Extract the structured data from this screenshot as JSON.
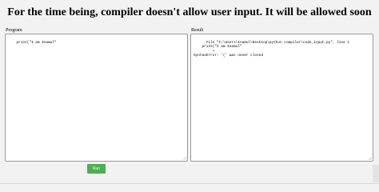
{
  "page": {
    "heading": "For the time being, compiler doesn't allow user input. It will be allowed soon"
  },
  "program": {
    "label": "Program",
    "code": "print(\"I am Inamul\""
  },
  "result": {
    "label": "Result",
    "output": "  File \"C:\\Users\\Inamul\\Desktop\\python compiler\\code_input.py\", line 1\n    print(\"I am Inamul\"\n         ^\nSyntaxError: '(' was never closed"
  },
  "actions": {
    "run_label": "Run"
  },
  "colors": {
    "background": "#f2f2f2",
    "run_button": "#4caf50",
    "box_border": "#9a9a9a"
  }
}
